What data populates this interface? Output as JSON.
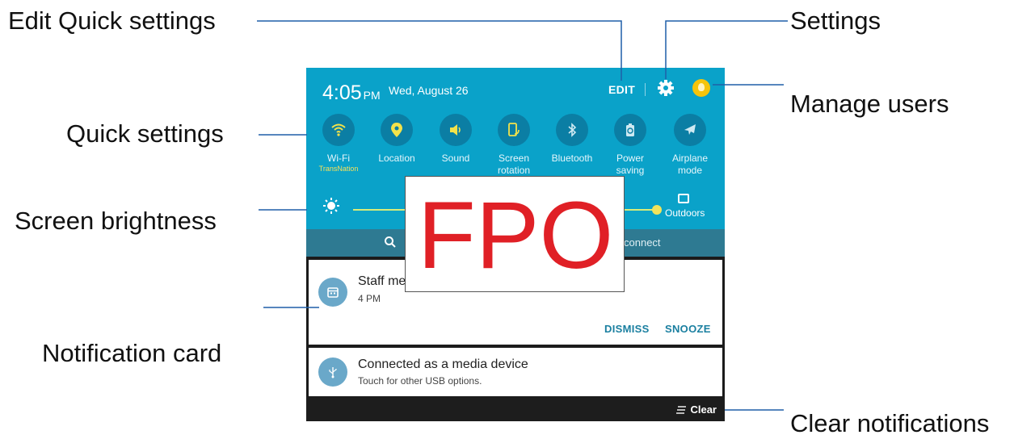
{
  "callouts": {
    "edit_quick_settings": "Edit Quick settings",
    "settings": "Settings",
    "manage_users": "Manage users",
    "quick_settings": "Quick settings",
    "screen_brightness": "Screen brightness",
    "notification_card": "Notification card",
    "clear_notifications": "Clear notifications"
  },
  "status": {
    "time": "4:05",
    "ampm": "PM",
    "date": "Wed, August 26",
    "edit_label": "EDIT",
    "settings_icon": "gear-icon",
    "user_icon": "user-avatar-icon"
  },
  "quick_tiles": [
    {
      "label": "Wi-Fi",
      "sub": "TransNation",
      "icon": "wifi-icon"
    },
    {
      "label": "Location",
      "sub": "",
      "icon": "location-pin-icon"
    },
    {
      "label": "Sound",
      "sub": "",
      "icon": "speaker-icon"
    },
    {
      "label": "Screen rotation",
      "sub": "",
      "icon": "screen-rotation-icon"
    },
    {
      "label": "Bluetooth",
      "sub": "",
      "icon": "bluetooth-icon"
    },
    {
      "label": "Power saving",
      "sub": "",
      "icon": "battery-icon"
    },
    {
      "label": "Airplane mode",
      "sub": "",
      "icon": "airplane-icon"
    }
  ],
  "brightness": {
    "icon": "sun-icon",
    "outdoors_label": "Outdoors"
  },
  "search": {
    "icon": "search-icon",
    "partial_text": "connect"
  },
  "notifications": [
    {
      "title": "Staff me",
      "subtitle": "4 PM",
      "icon": "calendar-icon",
      "actions": [
        "DISMISS",
        "SNOOZE"
      ]
    },
    {
      "title": "Connected as a media device",
      "subtitle": "Touch for other USB options.",
      "icon": "usb-icon",
      "actions": []
    }
  ],
  "clear_label": "Clear",
  "overlay_text": "FPO",
  "colors": {
    "panel_accent": "#0aa2c9",
    "fpo_red": "#e02026",
    "leader_line": "#1f5fa8"
  }
}
